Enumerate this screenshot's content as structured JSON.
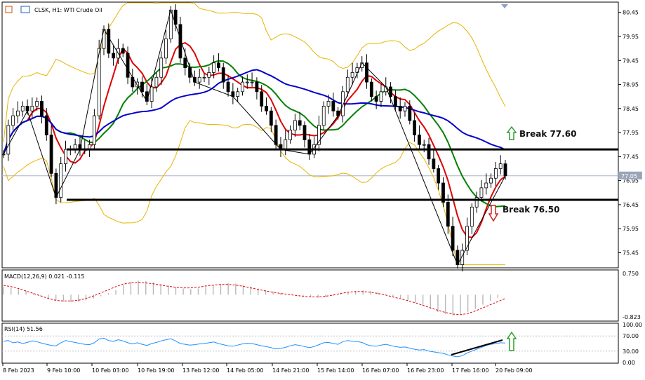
{
  "window": {
    "title": "CLSK, H1:  WTI Crude Oil"
  },
  "chart_data": {
    "type": "candlestick",
    "symbol": "CLSK",
    "timeframe": "H1",
    "instrument": "WTI Crude Oil",
    "title": "CLSK, H1:  WTI Crude Oil",
    "y_ticks": [
      "80.45",
      "79.95",
      "79.45",
      "78.95",
      "78.45",
      "77.95",
      "77.45",
      "76.95",
      "76.45",
      "75.95",
      "75.45"
    ],
    "ylim": [
      75.15,
      80.65
    ],
    "x_ticks": [
      "8 Feb 2023",
      "9 Feb 10:00",
      "10 Feb 03:00",
      "10 Feb 19:00",
      "13 Feb 12:00",
      "14 Feb 05:00",
      "14 Feb 21:00",
      "15 Feb 14:00",
      "16 Feb 07:00",
      "16 Feb 23:00",
      "17 Feb 16:00",
      "20 Feb 09:00"
    ],
    "current_price": "77.05",
    "close_approx": [
      77.5,
      78.1,
      78.3,
      78.4,
      78.5,
      78.4,
      78.5,
      78.6,
      78.3,
      77.9,
      77.1,
      76.6,
      77.3,
      77.6,
      77.6,
      77.7,
      77.6,
      77.6,
      77.7,
      78.3,
      79.7,
      80.1,
      79.6,
      79.5,
      79.7,
      79.6,
      79.1,
      78.9,
      79.0,
      78.8,
      78.6,
      78.9,
      79.1,
      79.5,
      79.9,
      80.5,
      80.2,
      79.5,
      79.3,
      79.1,
      79.0,
      79.1,
      79.1,
      79.2,
      79.4,
      79.3,
      79.0,
      78.8,
      78.7,
      78.8,
      79.0,
      79.0,
      79.0,
      78.8,
      78.5,
      78.4,
      78.1,
      77.7,
      77.6,
      77.8,
      78.0,
      78.2,
      78.1,
      77.8,
      77.5,
      77.7,
      78.1,
      78.5,
      78.6,
      78.4,
      78.3,
      78.8,
      79.1,
      79.2,
      79.3,
      79.4,
      79.0,
      78.7,
      78.6,
      78.8,
      78.9,
      78.7,
      78.5,
      78.4,
      78.5,
      78.2,
      77.9,
      77.7,
      77.7,
      77.4,
      77.2,
      76.9,
      76.5,
      76.0,
      75.5,
      75.2,
      75.5,
      76.0,
      76.4,
      76.6,
      76.8,
      76.9,
      77.0,
      77.2,
      77.3,
      77.05
    ],
    "horizontal_levels": [
      {
        "value": 77.6,
        "label": "Break 77.60",
        "arrow": "up"
      },
      {
        "value": 76.55,
        "label": "Break 76.50",
        "arrow": "down"
      }
    ],
    "moving_averages": [
      {
        "color": "#e00000"
      },
      {
        "color": "#008000"
      },
      {
        "color": "#0000cc"
      }
    ],
    "bollinger_color": "#e8b400",
    "zigzag_color": "#000000",
    "macd": {
      "label": "MACD(12,26,9) 0.021 -0.115",
      "y_ticks": [
        "0.750",
        "-0.823"
      ],
      "ylim": [
        -0.823,
        0.75
      ],
      "histogram": [
        0.25,
        0.22,
        0.18,
        0.12,
        0.05,
        -0.05,
        -0.12,
        -0.18,
        -0.22,
        -0.24,
        -0.22,
        -0.18,
        -0.12,
        -0.05,
        0.05,
        0.15,
        0.3,
        0.42,
        0.45,
        0.44,
        0.4,
        0.35,
        0.3,
        0.25,
        0.2,
        0.18,
        0.2,
        0.25,
        0.3,
        0.35,
        0.38,
        0.36,
        0.32,
        0.26,
        0.2,
        0.15,
        0.1,
        0.05,
        0.02,
        0.0,
        -0.05,
        -0.08,
        -0.1,
        -0.08,
        -0.04,
        0.02,
        0.08,
        0.12,
        0.14,
        0.12,
        0.08,
        0.02,
        -0.05,
        -0.12,
        -0.18,
        -0.25,
        -0.35,
        -0.45,
        -0.55,
        -0.62,
        -0.66,
        -0.64,
        -0.55,
        -0.45,
        -0.32,
        -0.2,
        -0.1,
        0.0
      ],
      "signal": [
        0.3,
        0.26,
        0.2,
        0.12,
        0.04,
        -0.04,
        -0.12,
        -0.18,
        -0.2,
        -0.2,
        -0.18,
        -0.12,
        -0.04,
        0.06,
        0.16,
        0.26,
        0.34,
        0.38,
        0.4,
        0.38,
        0.35,
        0.31,
        0.27,
        0.24,
        0.22,
        0.22,
        0.24,
        0.28,
        0.31,
        0.33,
        0.33,
        0.31,
        0.27,
        0.22,
        0.17,
        0.12,
        0.08,
        0.04,
        0.01,
        -0.02,
        -0.05,
        -0.07,
        -0.07,
        -0.05,
        -0.01,
        0.04,
        0.08,
        0.1,
        0.1,
        0.08,
        0.04,
        -0.01,
        -0.07,
        -0.13,
        -0.19,
        -0.26,
        -0.34,
        -0.42,
        -0.5,
        -0.57,
        -0.62,
        -0.64,
        -0.6,
        -0.52,
        -0.42,
        -0.32,
        -0.22,
        -0.12
      ]
    },
    "rsi": {
      "label": "RSI(14) 51.56",
      "y_ticks": [
        "100.00",
        "70.00",
        "30.00",
        "0.00"
      ],
      "ylim": [
        0,
        100
      ],
      "values": [
        56,
        58,
        52,
        54,
        50,
        53,
        57,
        55,
        51,
        48,
        45,
        44,
        52,
        58,
        55,
        53,
        50,
        48,
        47,
        52,
        62,
        64,
        58,
        56,
        60,
        57,
        52,
        49,
        52,
        48,
        45,
        50,
        53,
        57,
        60,
        63,
        57,
        50,
        48,
        46,
        47,
        49,
        50,
        52,
        54,
        50,
        47,
        44,
        43,
        46,
        49,
        51,
        50,
        47,
        44,
        42,
        39,
        36,
        37,
        40,
        44,
        47,
        45,
        42,
        39,
        42,
        47,
        52,
        53,
        50,
        48,
        55,
        58,
        56,
        55,
        53,
        47,
        44,
        43,
        46,
        48,
        45,
        42,
        40,
        41,
        38,
        35,
        33,
        34,
        30,
        28,
        26,
        24,
        20,
        17,
        15,
        18,
        25,
        30,
        35,
        40,
        45,
        48,
        50,
        52,
        51.56
      ],
      "trendline_color": "#000000",
      "arrow": "up"
    }
  }
}
